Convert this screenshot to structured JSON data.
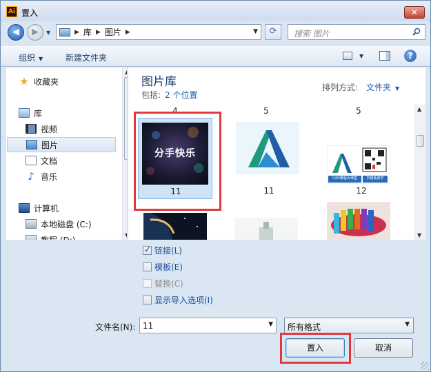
{
  "window": {
    "title": "置入",
    "app_icon_text": "Ai",
    "close_glyph": "✕"
  },
  "address": {
    "crumbs": [
      "库",
      "图片"
    ],
    "search_placeholder": "搜索 图片"
  },
  "toolbar": {
    "organize": "组织",
    "new_folder": "新建文件夹"
  },
  "nav": {
    "favorites": "收藏夹",
    "libraries": "库",
    "videos": "视频",
    "pictures": "图片",
    "documents": "文档",
    "music": "音乐",
    "computer": "计算机",
    "local_disk": "本地磁盘 (C:)",
    "tutorial_disk": "教程 (D:)"
  },
  "content": {
    "library_title": "图片库",
    "includes_label": "包括:",
    "includes_link": "2 个位置",
    "arrange_label": "排列方式:",
    "arrange_value": "文件夹",
    "top_labels": [
      "4",
      "5",
      "5"
    ],
    "tiles": [
      {
        "label": "11",
        "thumb_text": "分手快乐"
      },
      {
        "label": "11"
      },
      {
        "label": "12",
        "thumb_text": "CAD教程大课堂",
        "thumb_text2": "扫描免费学"
      }
    ]
  },
  "options": {
    "link": "链接(L)",
    "template": "模板(E)",
    "replace": "替换(C)",
    "show_import": "显示导入选项(I)"
  },
  "bottom": {
    "filename_label": "文件名(N):",
    "filename_value": "11",
    "format_value": "所有格式",
    "place_button": "置入",
    "cancel_button": "取消"
  },
  "colors": {
    "highlight_box": "#e0383e",
    "link_blue": "#1a5fb4"
  }
}
